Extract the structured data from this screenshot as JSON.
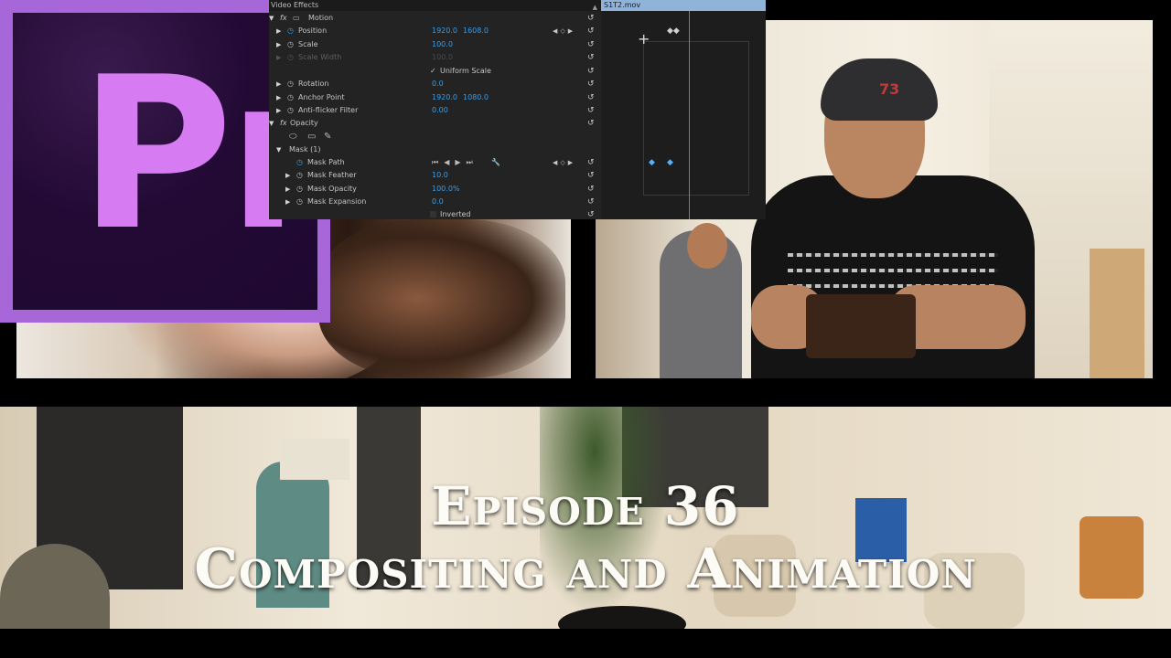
{
  "logo": {
    "text": "Pr",
    "color": "#d67bf1",
    "border": "#a767d8"
  },
  "effect_controls": {
    "header": "Video Effects",
    "collapse_icon": "scroll-up-icon",
    "rows": {
      "motion": {
        "label": "Motion",
        "fx": "fx"
      },
      "position": {
        "label": "Position",
        "v1": "1920.0",
        "v2": "1608.0"
      },
      "scale": {
        "label": "Scale",
        "v1": "100.0"
      },
      "scale_width": {
        "label": "Scale Width",
        "v1": "100.0"
      },
      "uniform_scale": {
        "label": "Uniform Scale",
        "check": "✓"
      },
      "rotation": {
        "label": "Rotation",
        "v1": "0.0"
      },
      "anchor_point": {
        "label": "Anchor Point",
        "v1": "1920.0",
        "v2": "1080.0"
      },
      "anti_flicker": {
        "label": "Anti-flicker Filter",
        "v1": "0.00"
      },
      "opacity": {
        "label": "Opacity",
        "fx": "fx"
      },
      "mask": {
        "label": "Mask (1)"
      },
      "mask_path": {
        "label": "Mask Path"
      },
      "mask_feather": {
        "label": "Mask Feather",
        "v1": "10.0"
      },
      "mask_opacity": {
        "label": "Mask Opacity",
        "v1": "100.0",
        "unit": "%"
      },
      "mask_expansion": {
        "label": "Mask Expansion",
        "v1": "0.0"
      },
      "inverted": {
        "label": "Inverted"
      }
    }
  },
  "timeline": {
    "clip_name": "S1T2.mov"
  },
  "title": {
    "line1": "Episode 36",
    "line2": "Compositing and Animation"
  },
  "photo_overlay": {
    "cap_logo": "73"
  },
  "colors": {
    "accent_blue": "#3b9ce6",
    "panel_bg": "#232323",
    "title_text": "#fdfbf5"
  }
}
